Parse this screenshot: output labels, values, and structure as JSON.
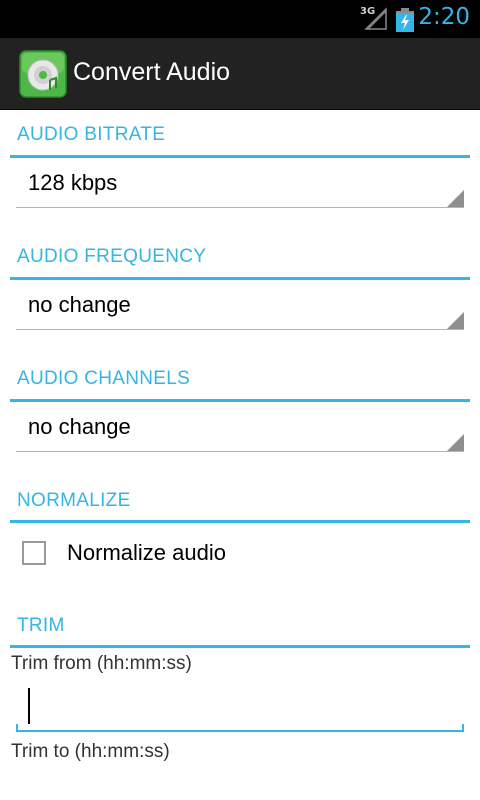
{
  "status_bar": {
    "signal_label": "3G",
    "time": "2:20"
  },
  "action_bar": {
    "title": "Convert Audio",
    "icon": "app-disc-icon"
  },
  "sections": {
    "bitrate": {
      "header": "AUDIO BITRATE",
      "value": "128 kbps"
    },
    "frequency": {
      "header": "AUDIO FREQUENCY",
      "value": "no change"
    },
    "channels": {
      "header": "AUDIO CHANNELS",
      "value": "no change"
    },
    "normalize": {
      "header": "NORMALIZE",
      "checkbox_label": "Normalize audio",
      "checked": false
    },
    "trim": {
      "header": "TRIM",
      "from_label": "Trim from (hh:mm:ss)",
      "from_value": "",
      "to_label": "Trim to (hh:mm:ss)"
    }
  },
  "colors": {
    "accent": "#33b5e5",
    "action_bar": "#222222",
    "status_bar": "#000000"
  }
}
